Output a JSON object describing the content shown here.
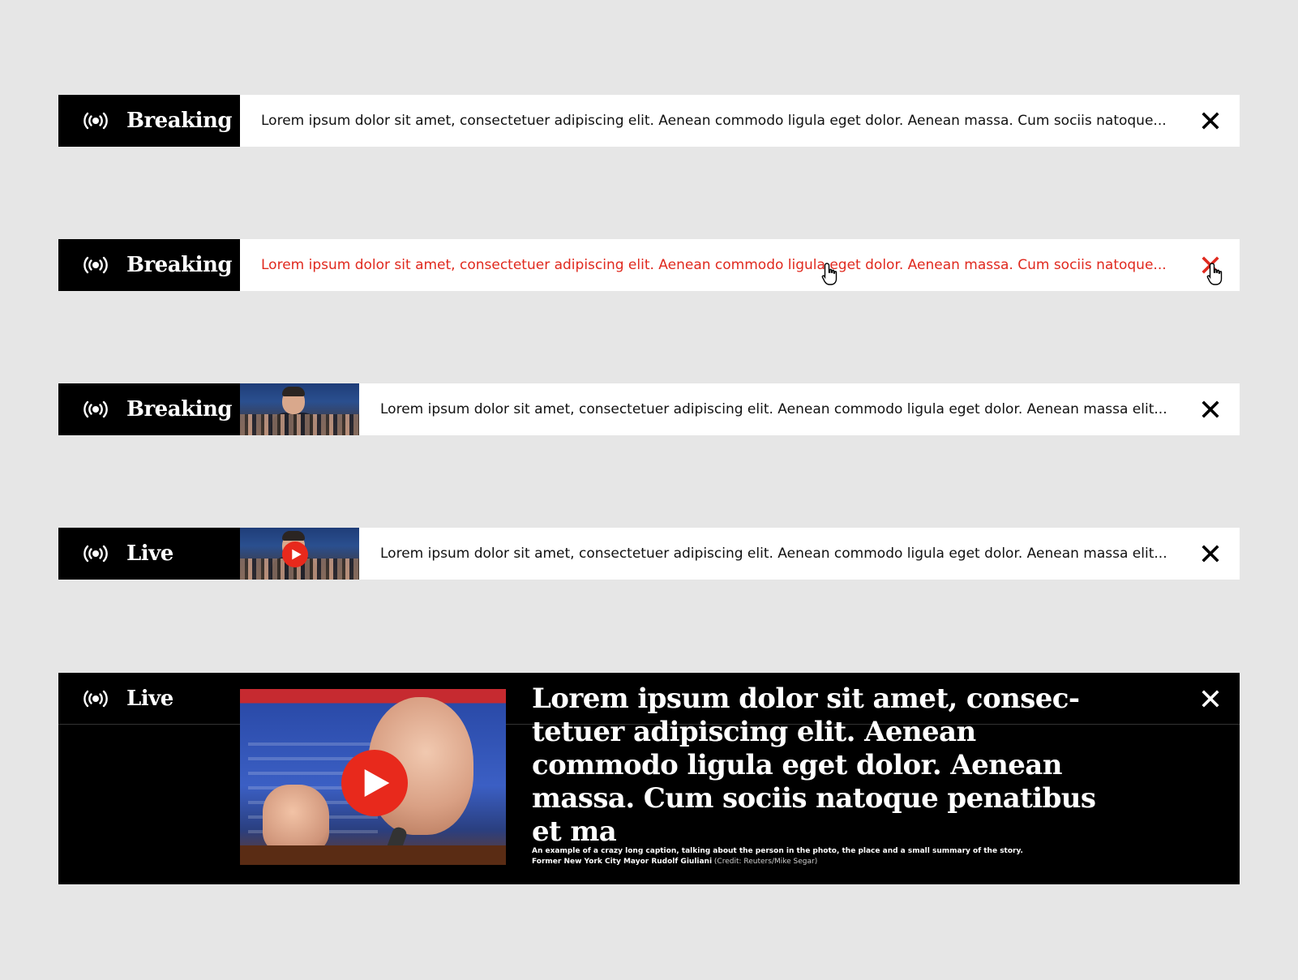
{
  "colors": {
    "background": "#e6e6e6",
    "label_bg": "#000000",
    "accent_red": "#e8291c",
    "hover_text": "#e0291e"
  },
  "icons": {
    "broadcast": "broadcast-icon",
    "close": "close-icon",
    "play": "play-icon",
    "cursor": "hand-pointer-icon"
  },
  "banners": [
    {
      "label": "Breaking",
      "headline": "Lorem ipsum dolor sit amet, consectetuer adipiscing elit. Aenean commodo ligula eget dolor. Aenean massa. Cum sociis natoque..."
    },
    {
      "label": "Breaking",
      "headline": "Lorem ipsum dolor sit amet, consectetuer adipiscing elit. Aenean commodo ligula eget dolor. Aenean massa. Cum sociis natoque...",
      "state": "hover"
    },
    {
      "label": "Breaking",
      "headline": "Lorem ipsum dolor sit amet, consectetuer adipiscing elit. Aenean commodo ligula eget dolor. Aenean massa elit..."
    },
    {
      "label": "Live",
      "headline": "Lorem ipsum dolor sit amet, consectetuer adipiscing elit. Aenean commodo ligula eget dolor. Aenean massa elit..."
    }
  ],
  "feature": {
    "label": "Live",
    "title": "Lorem ipsum dolor sit amet, consec-tetuer adipiscing elit. Aenean commodo ligula eget dolor. Aenean massa. Cum sociis natoque penatibus et ma",
    "caption_line1": "An example of a crazy long caption, talking about the person in the photo, the place and a small summary of the story.",
    "caption_name": "Former New York City Mayor Rudolf Giuliani",
    "caption_credit": " (Credit: Reuters/Mike Segar)"
  }
}
